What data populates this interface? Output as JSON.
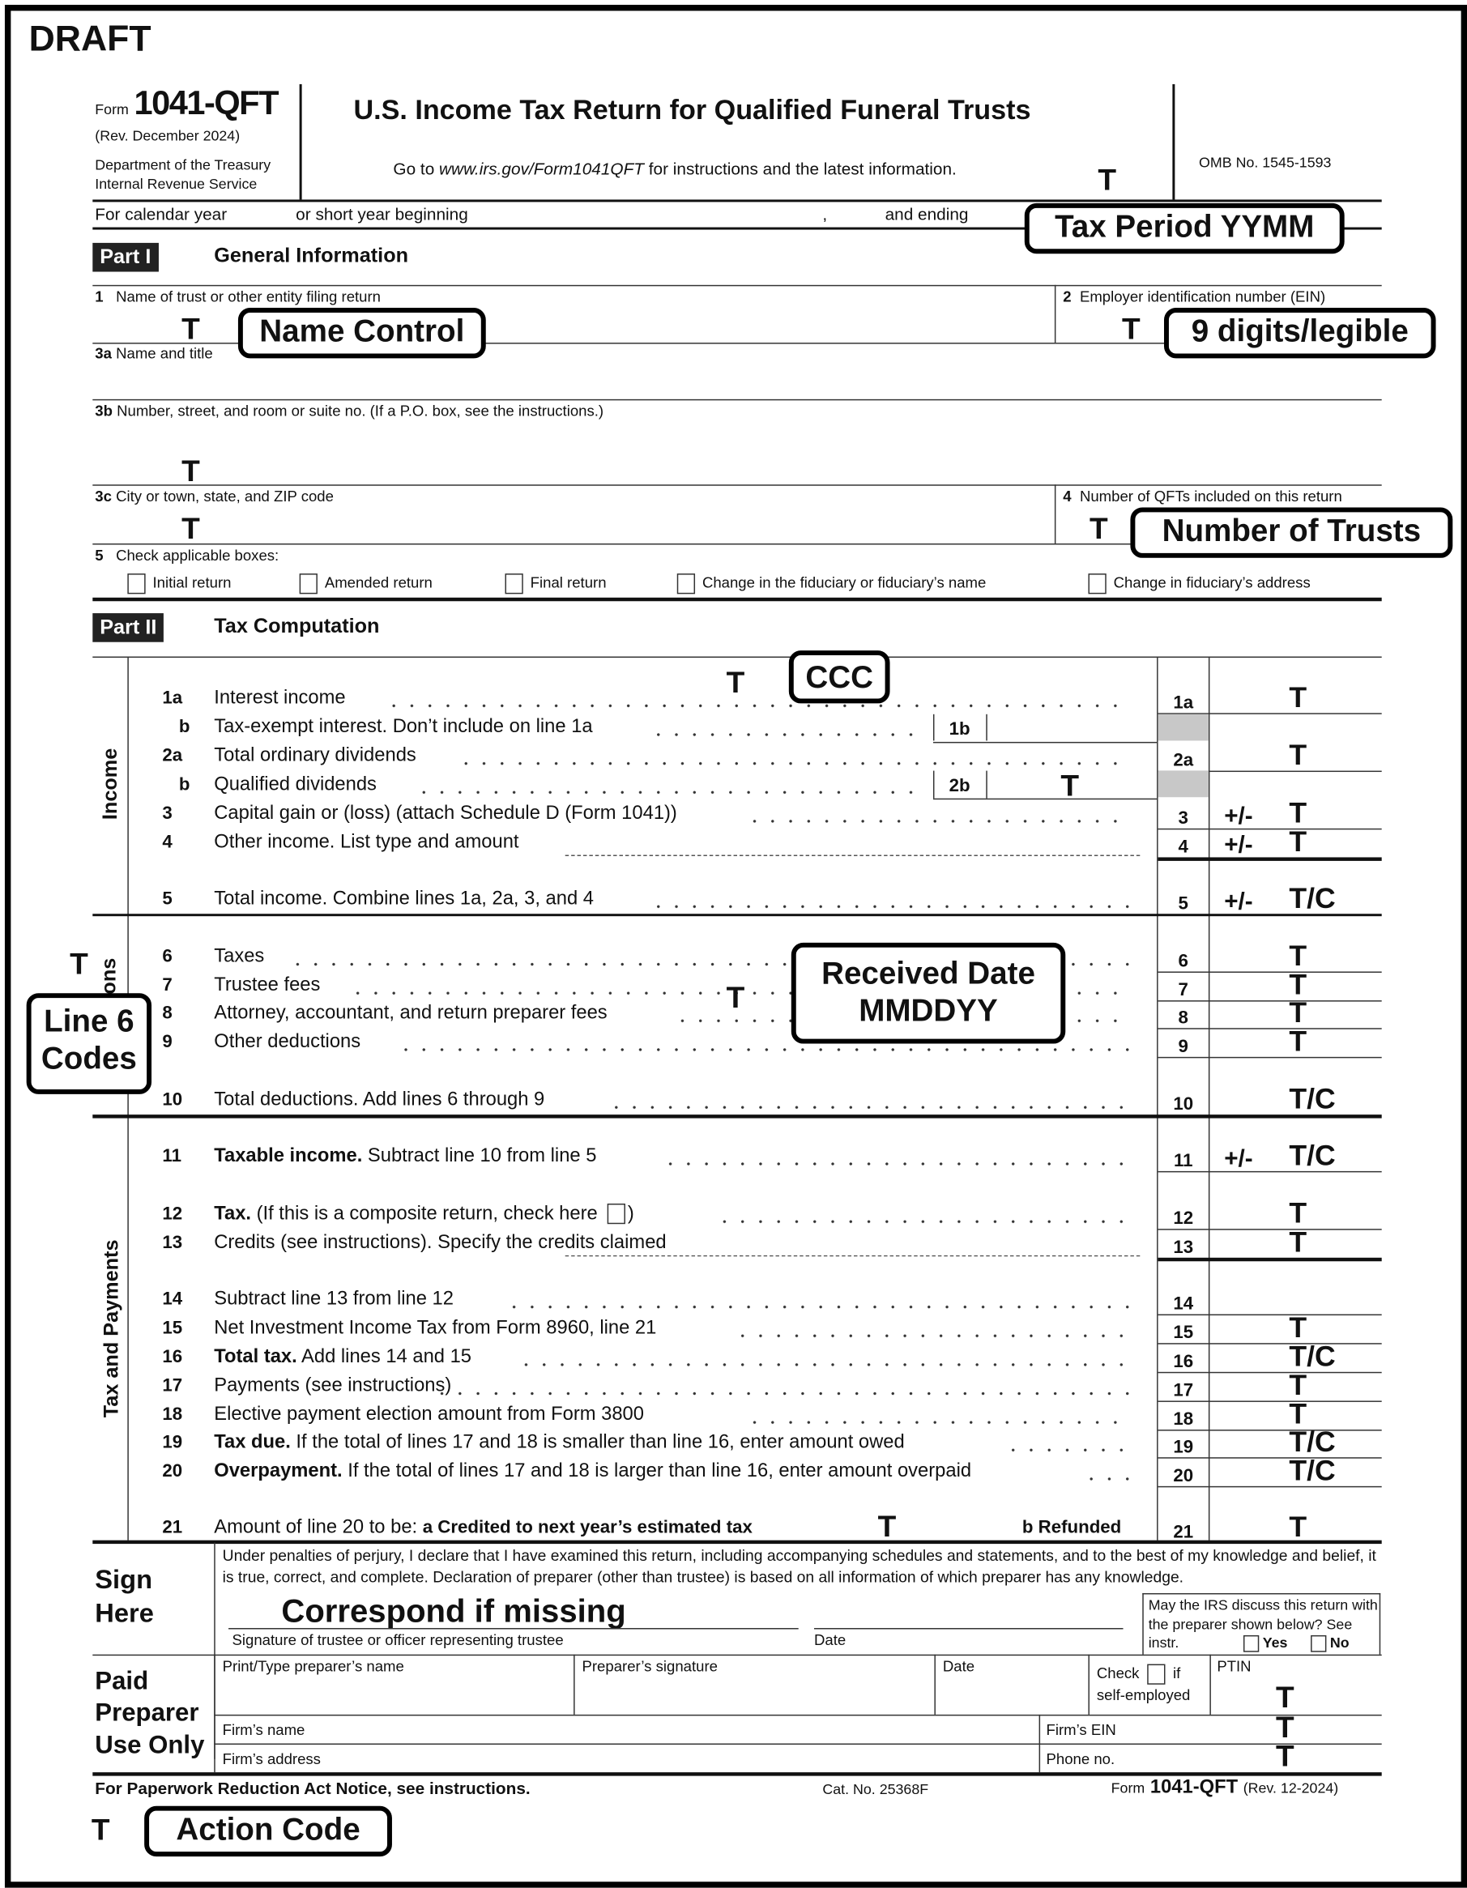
{
  "watermark": "DRAFT",
  "header": {
    "form_prefix": "Form",
    "form_number": "1041-QFT",
    "revision": "(Rev. December 2024)",
    "department": "Department of the Treasury",
    "service": "Internal Revenue Service",
    "title": "U.S. Income Tax Return for Qualified Funeral Trusts",
    "instructions_prefix": "Go to ",
    "instructions_url": "www.irs.gov/Form1041QFT",
    "instructions_suffix": " for instructions and the latest information.",
    "omb": "OMB No. 1545-1593"
  },
  "period": {
    "calendar_year": "For calendar year",
    "short_year": "or short year beginning",
    "comma": ",",
    "ending": "and ending"
  },
  "part1": {
    "badge": "Part I",
    "title": "General Information",
    "line1": "Name of trust or other entity filing return",
    "line2": "Employer identification number (EIN)",
    "line3a": "Name and title",
    "line3b": "Number, street, and room or suite no. (If a P.O. box, see the instructions.)",
    "line3c": "City or town, state, and ZIP code",
    "line4": "Number of QFTs included on this return",
    "line5": "Check applicable boxes:",
    "checkboxes": [
      {
        "label": "Initial return",
        "checked": false
      },
      {
        "label": "Amended return",
        "checked": false
      },
      {
        "label": "Final return",
        "checked": false
      },
      {
        "label": "Change in the fiduciary or fiduciary’s name",
        "checked": false
      },
      {
        "label": "Change in fiduciary’s address",
        "checked": false
      }
    ],
    "nums": {
      "n1": "1",
      "n2": "2",
      "n3a": "3a",
      "n3b": "3b",
      "n3c": "3c",
      "n4": "4",
      "n5": "5"
    }
  },
  "part2": {
    "badge": "Part II",
    "title": "Tax Computation",
    "section_income": "Income",
    "section_deductions": "Deductions",
    "section_tax": "Tax and Payments",
    "lines": [
      {
        "num": "1a",
        "text": "Interest income",
        "box": "1a",
        "code": "T"
      },
      {
        "num": "b",
        "text": "Tax-exempt interest. Don’t include on line 1a",
        "inner_box": "1b"
      },
      {
        "num": "2a",
        "text": "Total ordinary dividends",
        "box": "2a",
        "code": "T"
      },
      {
        "num": "b",
        "text": "Qualified dividends",
        "inner_box": "2b",
        "inner_code": "T"
      },
      {
        "num": "3",
        "text": "Capital gain or (loss) (attach Schedule D (Form 1041))",
        "box": "3",
        "sign": "+/-",
        "code": "T"
      },
      {
        "num": "4",
        "text": "Other income. List type and amount",
        "box": "4",
        "sign": "+/-",
        "code": "T"
      },
      {
        "num": "5",
        "text": "Total income. Combine lines 1a, 2a, 3, and 4",
        "box": "5",
        "sign": "+/-",
        "code": "T/C"
      },
      {
        "num": "6",
        "text": "Taxes",
        "box": "6",
        "code": "T"
      },
      {
        "num": "7",
        "text": "Trustee fees",
        "box": "7",
        "code": "T"
      },
      {
        "num": "8",
        "text": "Attorney, accountant, and return preparer fees",
        "box": "8",
        "code": "T"
      },
      {
        "num": "9",
        "text": "Other deductions",
        "box": "9",
        "code": "T"
      },
      {
        "num": "10",
        "text": "Total deductions. Add lines 6 through 9",
        "box": "10",
        "code": "T/C"
      },
      {
        "num": "11",
        "bold": "Taxable income.",
        "text": " Subtract line 10 from line 5",
        "box": "11",
        "sign": "+/-",
        "code": "T/C"
      },
      {
        "num": "12",
        "bold": "Tax.",
        "text": " (If this is a composite return, check here",
        "text_after": ")",
        "box": "12",
        "code": "T"
      },
      {
        "num": "13",
        "text": "Credits (see instructions). Specify the credits claimed",
        "box": "13",
        "code": "T"
      },
      {
        "num": "14",
        "text": "Subtract line 13 from line 12",
        "box": "14",
        "code": ""
      },
      {
        "num": "15",
        "text": "Net Investment Income Tax from Form 8960, line 21",
        "box": "15",
        "code": "T"
      },
      {
        "num": "16",
        "bold": "Total tax.",
        "text": " Add lines 14 and 15",
        "box": "16",
        "code": "T/C"
      },
      {
        "num": "17",
        "text": "Payments (see instructions)",
        "box": "17",
        "code": "T"
      },
      {
        "num": "18",
        "text": "Elective payment election amount from Form 3800",
        "box": "18",
        "code": "T"
      },
      {
        "num": "19",
        "bold": "Tax due.",
        "text": " If the total of lines 17 and 18 is smaller than line 16, enter amount owed",
        "box": "19",
        "code": "T/C"
      },
      {
        "num": "20",
        "bold": "Overpayment.",
        "text": " If the total of lines 17 and 18 is larger than line 16, enter amount overpaid",
        "box": "20",
        "code": "T/C"
      },
      {
        "num": "21",
        "text": "Amount of line 20 to be: ",
        "bold_a": "a  Credited to next year’s estimated tax",
        "bold_b": "b Refunded",
        "box": "21",
        "code": "T"
      }
    ]
  },
  "sign": {
    "title_line1": "Sign",
    "title_line2": "Here",
    "perjury": "Under penalties of perjury, I declare that I have examined this return, including accompanying schedules and statements, and to the best of my knowledge and belief, it is true, correct, and complete. Declaration of preparer (other than trustee) is based on all information of which preparer has any knowledge.",
    "signature_label": "Signature of trustee or officer representing trustee",
    "date_label": "Date",
    "discuss": "May the IRS discuss this return with the preparer shown below? See instr.",
    "yes": "Yes",
    "no": "No"
  },
  "preparer": {
    "title_line1": "Paid",
    "title_line2": "Preparer",
    "title_line3": "Use Only",
    "name_label": "Print/Type preparer’s name",
    "signature_label": "Preparer’s signature",
    "date_label": "Date",
    "check_label": "Check",
    "check_if": "if",
    "self_employed": "self-employed",
    "ptin": "PTIN",
    "firm_name": "Firm’s name",
    "firm_ein": "Firm’s EIN",
    "firm_address": "Firm’s address",
    "phone": "Phone no."
  },
  "footer": {
    "paperwork": "For Paperwork Reduction Act Notice, see instructions.",
    "cat": "Cat. No. 25368F",
    "form_prefix": "Form",
    "form_number": "1041-QFT",
    "rev": "(Rev. 12-2024)"
  },
  "annotations": {
    "tax_period": "Tax Period YYMM",
    "name_control": "Name Control",
    "ein": "9 digits/legible",
    "num_trusts": "Number of Trusts",
    "ccc": "CCC",
    "received_date_1": "Received Date",
    "received_date_2": "MMDDYY",
    "line6_codes_1": "Line 6",
    "line6_codes_2": "Codes",
    "correspond": "Correspond if missing",
    "action_code": "Action Code",
    "T": "T"
  }
}
